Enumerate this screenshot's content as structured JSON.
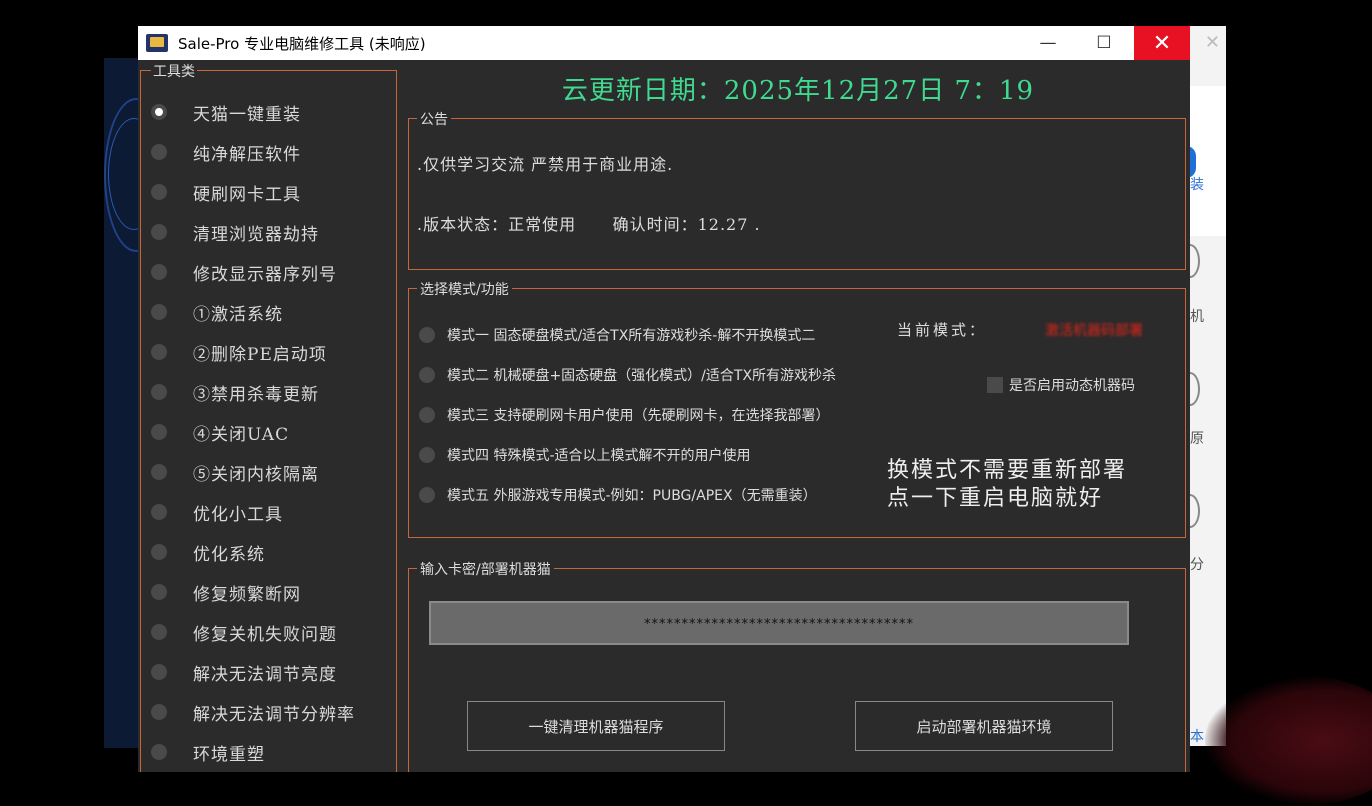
{
  "window": {
    "title": "Sale-Pro 专业电脑维修工具 (未响应)",
    "minimize": "—",
    "maximize": "☐",
    "close": "✕"
  },
  "background_window": {
    "close": "✕",
    "chars": [
      "装",
      "机",
      "原",
      "分",
      "本"
    ]
  },
  "tools_group": {
    "legend": "工具类",
    "selected_index": 0,
    "items": [
      "天猫一键重装",
      "纯净解压软件",
      "硬刷网卡工具",
      "清理浏览器劫持",
      "修改显示器序列号",
      "①激活系统",
      "②删除PE启动项",
      "③禁用杀毒更新",
      "④关闭UAC",
      "⑤关闭内核隔离",
      "优化小工具",
      "优化系统",
      "修复频繁断网",
      "修复关机失败问题",
      "解决无法调节亮度",
      "解决无法调节分辨率",
      "环境重塑"
    ]
  },
  "cloud_update": "云更新日期：2025年12月27日  7：19",
  "announcement": {
    "legend": "公告",
    "line1": ".仅供学习交流 严禁用于商业用途.",
    "line2": ".版本状态：正常使用      确认时间：12.27 ."
  },
  "mode_group": {
    "legend": "选择模式/功能",
    "modes": [
      "模式一 固态硬盘模式/适合TX所有游戏秒杀-解不开换模式二",
      "模式二 机械硬盘+固态硬盘（强化模式）/适合TX所有游戏秒杀",
      "模式三 支持硬刷网卡用户使用（先硬刷网卡，在选择我部署）",
      "模式四 特殊模式-适合以上模式解不开的用户使用",
      "模式五 外服游戏专用模式-例如：PUBG/APEX（无需重装）"
    ],
    "current_mode_label": "当前模式：",
    "current_mode_value": "激活机器码部署",
    "dynamic_code_label": "是否启用动态机器码",
    "note_line1": "换模式不需要重新部署",
    "note_line2": "点一下重启电脑就好"
  },
  "key_group": {
    "legend": "输入卡密/部署机器猫",
    "key_value": "************************************",
    "clean_button": "一键清理机器猫程序",
    "deploy_button": "启动部署机器猫环境"
  },
  "colors": {
    "accent_green": "#3fd98f",
    "border_orange": "#c8653a",
    "close_red": "#e81123",
    "mode_red": "#e0251a"
  }
}
